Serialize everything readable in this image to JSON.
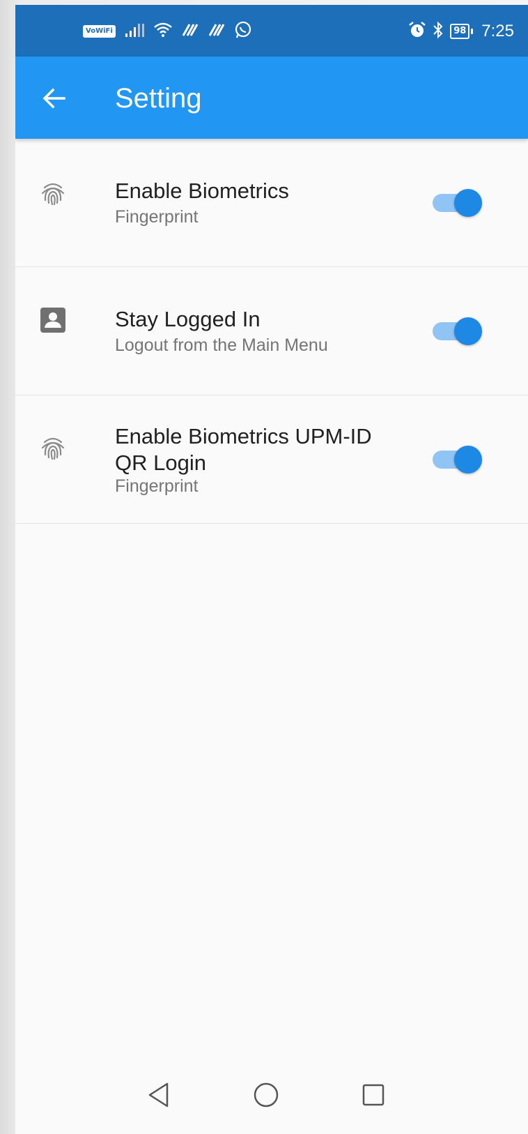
{
  "status_bar": {
    "vowifi_label": "VoWiFi",
    "battery_level": "98",
    "time": "7:25",
    "icons": [
      "vowifi-icon",
      "signal-icon",
      "wifi-icon",
      "data-icon",
      "data-icon",
      "whatsapp-icon",
      "alarm-icon",
      "bluetooth-icon",
      "battery-icon"
    ]
  },
  "app_bar": {
    "title": "Setting",
    "back_icon": "arrow-left-icon",
    "background_color": "#2196f3"
  },
  "settings": [
    {
      "icon": "fingerprint-icon",
      "title": "Enable Biometrics",
      "subtitle": "Fingerprint",
      "enabled": true
    },
    {
      "icon": "account-box-icon",
      "title": "Stay Logged In",
      "subtitle": "Logout from the Main Menu",
      "enabled": true
    },
    {
      "icon": "fingerprint-icon",
      "title": "Enable Biometrics UPM-ID QR Login",
      "subtitle": "Fingerprint",
      "enabled": true
    }
  ],
  "nav_bar": {
    "buttons": [
      "back-triangle-icon",
      "home-circle-icon",
      "recents-square-icon"
    ]
  },
  "colors": {
    "status_bar": "#1c6fb8",
    "accent": "#1e88e5",
    "track": "#90c4f5"
  }
}
